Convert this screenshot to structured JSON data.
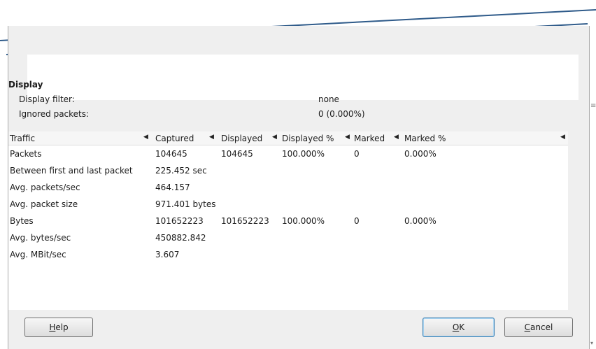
{
  "display": {
    "section_title": "Display",
    "filter_label": "Display filter:",
    "filter_value": "none",
    "ignored_label": "Ignored packets:",
    "ignored_value": "0 (0.000%)"
  },
  "table": {
    "headers": [
      "Traffic",
      "Captured",
      "Displayed",
      "Displayed %",
      "Marked",
      "Marked %"
    ],
    "rows": [
      [
        "Packets",
        "104645",
        "104645",
        "100.000%",
        "0",
        "0.000%"
      ],
      [
        "Between first and last packet",
        "225.452 sec",
        "",
        "",
        "",
        ""
      ],
      [
        "Avg. packets/sec",
        "464.157",
        "",
        "",
        "",
        ""
      ],
      [
        "Avg. packet size",
        "971.401 bytes",
        "",
        "",
        "",
        ""
      ],
      [
        "Bytes",
        "101652223",
        "101652223",
        "100.000%",
        "0",
        "0.000%"
      ],
      [
        "Avg. bytes/sec",
        "450882.842",
        "",
        "",
        "",
        ""
      ],
      [
        "Avg. MBit/sec",
        "3.607",
        "",
        "",
        "",
        ""
      ]
    ]
  },
  "buttons": {
    "help_mnemonic": "H",
    "help_rest": "elp",
    "ok_mnemonic": "O",
    "ok_rest": "K",
    "cancel_mnemonic": "C",
    "cancel_rest": "ancel"
  },
  "icons": {
    "sort": "sort-arrow-icon",
    "grip": "scrollbar-grip-icon",
    "resize": "resize-grip-icon"
  }
}
